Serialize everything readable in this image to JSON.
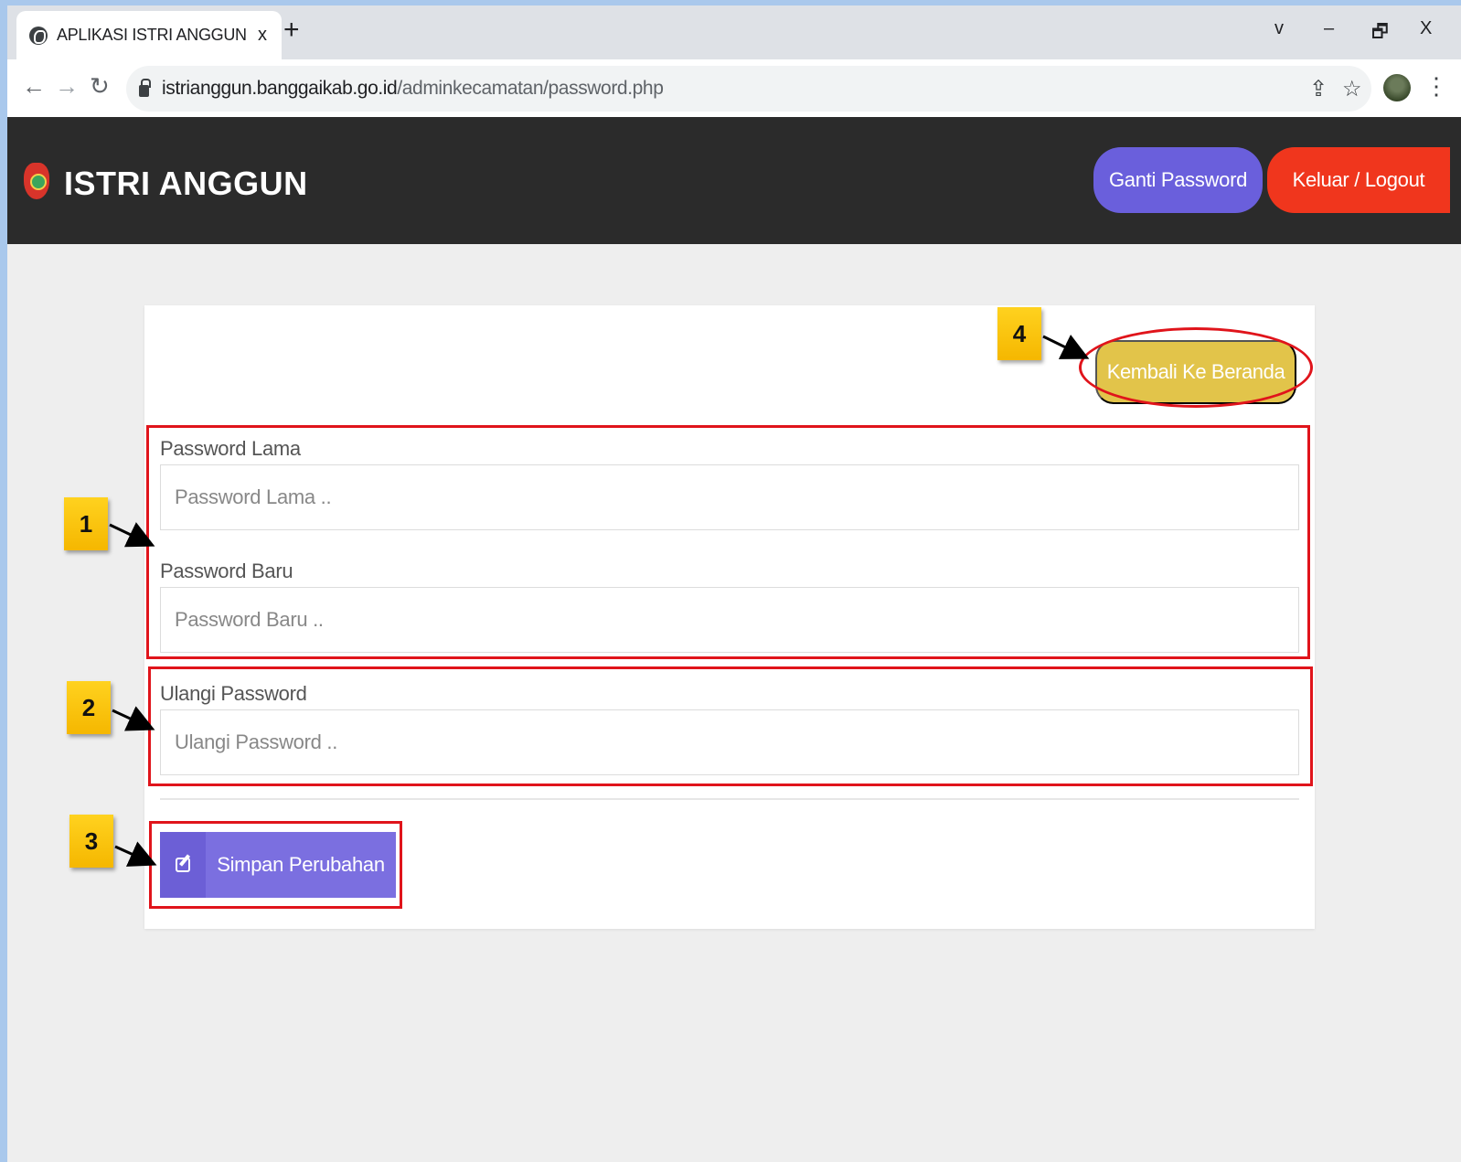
{
  "browser": {
    "tab_title": "APLIKASI ISTRI ANGGUN",
    "tab_close": "x",
    "new_tab": "+",
    "url_host": "istrianggun.banggaikab.go.id",
    "url_path": "/adminkecamatan/password.php",
    "window_controls": {
      "minimize": "–",
      "maximize": "🗗",
      "close": "X",
      "chevron": "v"
    }
  },
  "header": {
    "title": "ISTRI ANGGUN",
    "ganti_password": "Ganti Password",
    "logout": "Keluar / Logout"
  },
  "form": {
    "back_button": "Kembali Ke Beranda",
    "old_password": {
      "label": "Password Lama",
      "placeholder": "Password Lama .."
    },
    "new_password": {
      "label": "Password Baru",
      "placeholder": "Password Baru .."
    },
    "repeat_password": {
      "label": "Ulangi Password",
      "placeholder": "Ulangi Password .."
    },
    "save_button": "Simpan Perubahan"
  },
  "annotations": [
    "1",
    "2",
    "3",
    "4"
  ],
  "colors": {
    "header_bg": "#2b2b2b",
    "ganti_btn": "#6a5fdc",
    "logout_btn": "#f0361d",
    "back_btn": "#e2c44a",
    "save_btn": "#7b6fe0",
    "annotation_red": "#e0141b",
    "callout_yellow": "#ffd21f"
  },
  "icons": {
    "tab": "globe-icon",
    "back": "arrow-left-icon",
    "forward": "arrow-right-icon",
    "reload": "reload-icon",
    "lock": "lock-icon",
    "share": "share-icon",
    "bookmark": "star-icon",
    "menu": "kebab-menu-icon",
    "save": "edit-icon"
  }
}
